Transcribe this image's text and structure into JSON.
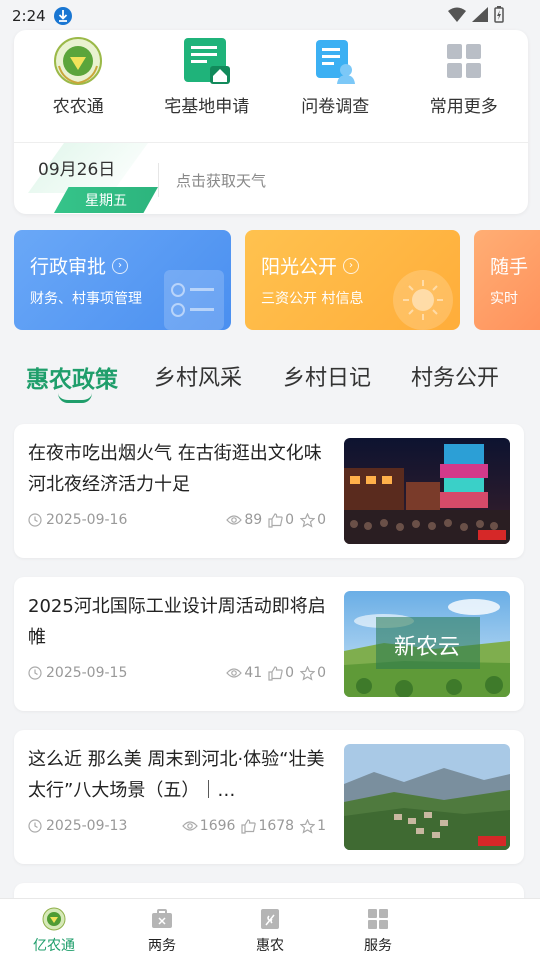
{
  "status_bar": {
    "time": "2:24"
  },
  "quick_actions": [
    {
      "label": "农农通",
      "icon": "agri-emblem-icon"
    },
    {
      "label": "宅基地申请",
      "icon": "document-house-icon"
    },
    {
      "label": "问卷调查",
      "icon": "survey-icon"
    },
    {
      "label": "常用更多",
      "icon": "grid-icon"
    }
  ],
  "weather": {
    "date": "09月26日",
    "weekday": "星期五",
    "prompt": "点击获取天气"
  },
  "banners": [
    {
      "title": "行政审批",
      "subtitle": "财务、村事项管理",
      "color": "#5a9cf4"
    },
    {
      "title": "阳光公开",
      "subtitle": "三资公开 村信息",
      "color": "#ffb845"
    },
    {
      "title": "随手",
      "subtitle": "实时",
      "color": "#ff9a64"
    }
  ],
  "tabs": [
    "惠农政策",
    "乡村风采",
    "乡村日记",
    "村务公开"
  ],
  "news": [
    {
      "title": "在夜市吃出烟火气 在古街逛出文化味 河北夜经济活力十足",
      "date": "2025-09-16",
      "views": "89",
      "likes": "0",
      "favs": "0",
      "thumb_text": ""
    },
    {
      "title": "2025河北国际工业设计周活动即将启帷",
      "date": "2025-09-15",
      "views": "41",
      "likes": "0",
      "favs": "0",
      "thumb_text": "新农云"
    },
    {
      "title": "这么近 那么美 周末到河北·体验“壮美太行”八大场景（五）｜…",
      "date": "2025-09-13",
      "views": "1696",
      "likes": "1678",
      "favs": "1",
      "thumb_text": ""
    }
  ],
  "bottom_nav": [
    {
      "label": "亿农通",
      "active": true
    },
    {
      "label": "两务",
      "active": false
    },
    {
      "label": "惠农",
      "active": false
    },
    {
      "label": "服务",
      "active": false
    }
  ],
  "colors": {
    "accent": "#1f9e6b",
    "blue": "#5a9cf4",
    "orange": "#ffb845"
  }
}
